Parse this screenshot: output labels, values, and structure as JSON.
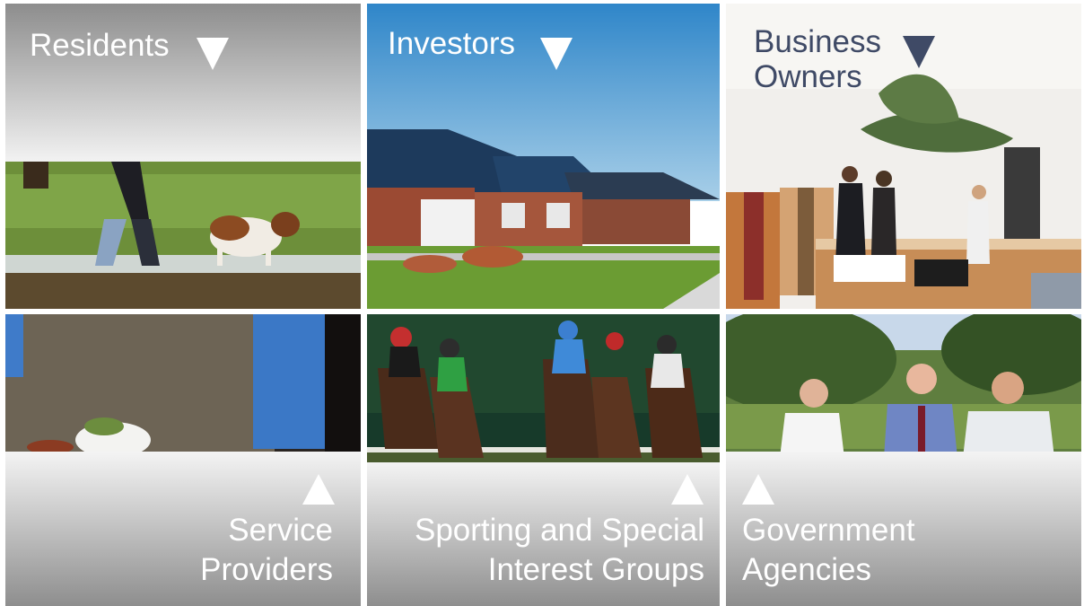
{
  "tiles": {
    "residents": {
      "label": "Residents"
    },
    "investors": {
      "label": "Investors"
    },
    "business_owners": {
      "line1": "Business",
      "line2": "Owners"
    },
    "service_providers": {
      "line1": "Service",
      "line2": "Providers"
    },
    "sporting_groups": {
      "line1": "Sporting and Special",
      "line2": "Interest Groups"
    },
    "government_agencies": {
      "line1": "Government",
      "line2": "Agencies"
    }
  },
  "icons": {
    "down_arrow": "triangle-down-icon",
    "up_arrow": "triangle-up-icon"
  },
  "colors": {
    "label_white": "#ffffff",
    "label_dark": "#3f4a66",
    "gradient_dark": "#8d8d8d",
    "gradient_light": "#f2f2f2"
  }
}
